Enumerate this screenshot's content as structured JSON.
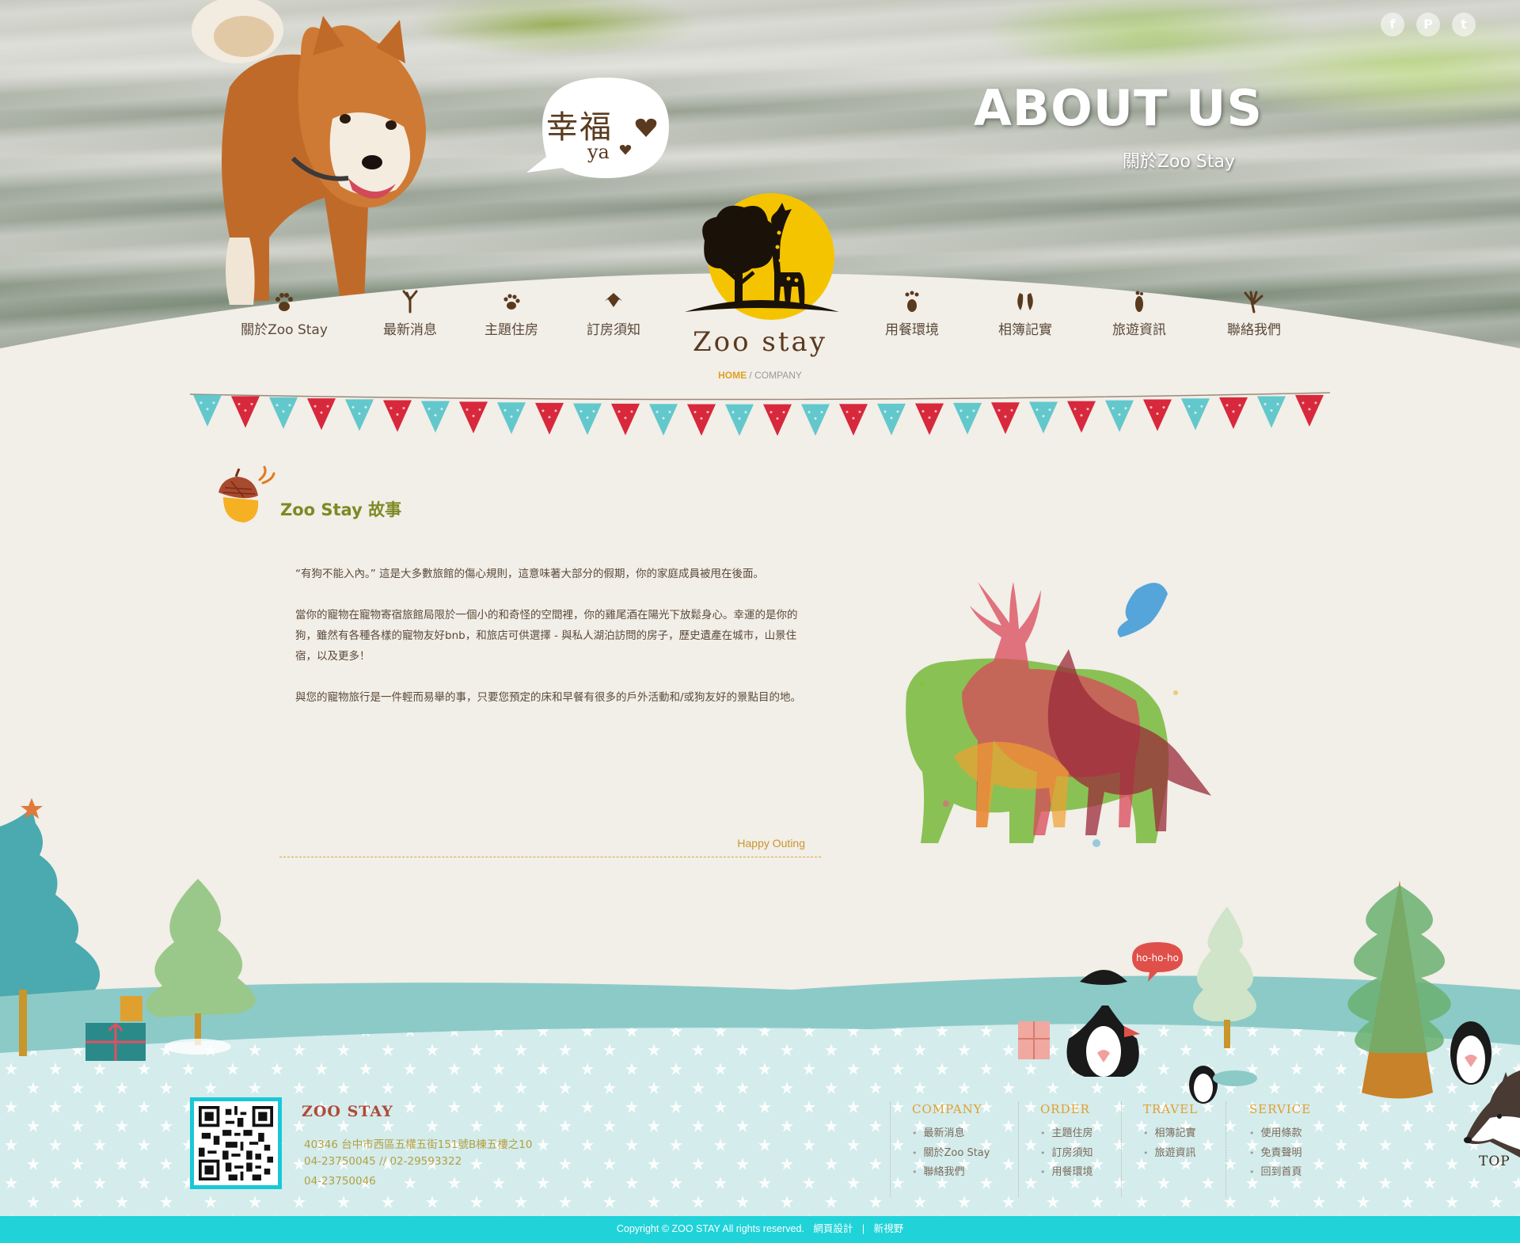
{
  "hero": {
    "title": "ABOUT US",
    "subtitle": "關於Zoo Stay",
    "bubble_main": "幸福",
    "bubble_sub": "ya"
  },
  "social": [
    {
      "name": "facebook",
      "glyph": "f"
    },
    {
      "name": "plurk",
      "glyph": "P"
    },
    {
      "name": "twitter",
      "glyph": "t"
    }
  ],
  "logo": {
    "text": "Zoo  stay"
  },
  "nav": [
    {
      "label": "關於Zoo Stay",
      "icon": "paw-icon"
    },
    {
      "label": "最新消息",
      "icon": "bird-foot-icon"
    },
    {
      "label": "主題住房",
      "icon": "cat-paw-icon"
    },
    {
      "label": "訂房須知",
      "icon": "duck-foot-icon"
    },
    {
      "label": "用餐環境",
      "icon": "bear-paw-icon"
    },
    {
      "label": "相簿記實",
      "icon": "hoof-icon"
    },
    {
      "label": "旅遊資訊",
      "icon": "footprint-icon"
    },
    {
      "label": "聯絡我們",
      "icon": "claw-icon"
    }
  ],
  "breadcrumb": {
    "home": "HOME",
    "sep": "/",
    "current": "COMPANY"
  },
  "section": {
    "title": "Zoo Stay 故事"
  },
  "story": [
    "“有狗不能入內。” 這是大多數旅館的傷心規則，這意味著大部分的假期，你的家庭成員被甩在後面。",
    "當你的寵物在寵物寄宿旅館局限於一個小的和奇怪的空間裡，你的雞尾酒在陽光下放鬆身心。幸運的是你的狗，雖然有各種各樣的寵物友好bnb，和旅店可供選擇 - 與私人湖泊訪問的房子，歷史遺產在城市，山景住宿，以及更多！",
    "與您的寵物旅行是一件輕而易舉的事，只要您預定的床和早餐有很多的戶外活動和/或狗友好的景點目的地。"
  ],
  "happy_outing": "Happy Outing",
  "winter": {
    "speech": "ho-ho-ho"
  },
  "footer": {
    "brand": "ZOO STAY",
    "address": "40346 台中市西區五權五街151號B棟五樓之10",
    "tel": "04-23750045 // 02-29593322",
    "fax": "04-23750046",
    "columns": [
      {
        "head": "COMPANY",
        "links": [
          "最新消息",
          "關於Zoo Stay",
          "聯絡我們"
        ]
      },
      {
        "head": "ORDER",
        "links": [
          "主題住房",
          "訂房須知",
          "用餐環境"
        ]
      },
      {
        "head": "TRAVEL",
        "links": [
          "相簿記實",
          "旅遊資訊"
        ]
      },
      {
        "head": "SERVICE",
        "links": [
          "使用條款",
          "免責聲明",
          "回到首頁"
        ]
      }
    ],
    "top_label": "TOP",
    "copyright": "Copyright © ZOO STAY All rights reserved.",
    "design": "網頁設計",
    "sep": "|",
    "designer": "新視野"
  },
  "colors": {
    "paper": "#f2eee8",
    "accent_teal": "#1fd3d9",
    "title_green": "#7c8a22",
    "logo_yellow": "#f5c400",
    "bunting_red": "#d8283c",
    "bunting_teal": "#63c8cc"
  }
}
